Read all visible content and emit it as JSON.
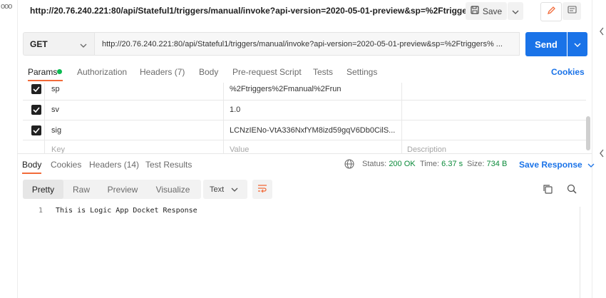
{
  "window": {
    "left_dots": "ooo",
    "title": "http://20.76.240.221:80/api/Stateful1/triggers/manual/invoke?api-version=2020-05-01-preview&sp=%2Ftrigger...",
    "save_label": "Save"
  },
  "request": {
    "method": "GET",
    "url": "http://20.76.240.221:80/api/Stateful1/triggers/manual/invoke?api-version=2020-05-01-preview&sp=%2Ftriggers% ...",
    "send_label": "Send"
  },
  "request_tabs": {
    "items": [
      "Params",
      "Authorization",
      "Headers (7)",
      "Body",
      "Pre-request Script",
      "Tests",
      "Settings"
    ],
    "cookies": "Cookies"
  },
  "params": {
    "rows": [
      {
        "key": "sp",
        "value": "%2Ftriggers%2Fmanual%2Frun",
        "checked": true
      },
      {
        "key": "sv",
        "value": "1.0",
        "checked": true
      },
      {
        "key": "sig",
        "value": "LCNzIENo-VtA336NxfYM8izd59gqV6Db0CilS...",
        "checked": true
      }
    ],
    "placeholders": {
      "key": "Key",
      "value": "Value",
      "description": "Description"
    }
  },
  "response_tabs": {
    "items": [
      "Body",
      "Cookies",
      "Headers (14)",
      "Test Results"
    ]
  },
  "response_meta": {
    "status_label": "Status:",
    "status_value": "200 OK",
    "time_label": "Time:",
    "time_value": "6.37 s",
    "size_label": "Size:",
    "size_value": "734 B",
    "save_response": "Save Response"
  },
  "view_modes": [
    "Pretty",
    "Raw",
    "Preview",
    "Visualize"
  ],
  "format": "Text",
  "body_lines": [
    {
      "num": "1",
      "text": "This is Logic App Docket Response"
    }
  ],
  "colors": {
    "accent": "#1a73e8",
    "tab_indicator": "#f26b3a",
    "status_ok": "#0b8a3a",
    "params_dot": "#0cbb52"
  },
  "icons": [
    "save-icon",
    "pencil-icon",
    "comment-icon",
    "chevron-down-icon",
    "globe-icon",
    "wrap-lines-icon",
    "copy-icon",
    "search-icon",
    "chevron-left-icon",
    "checkbox-checked-icon"
  ]
}
